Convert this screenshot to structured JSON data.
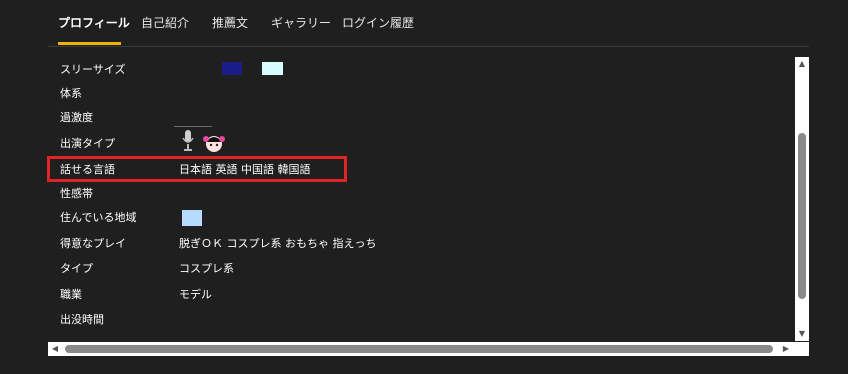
{
  "tabs": [
    {
      "label": "プロフィール",
      "active": true
    },
    {
      "label": "自己紹介",
      "active": false
    },
    {
      "label": "推薦文",
      "active": false
    },
    {
      "label": "ギャラリー",
      "active": false
    },
    {
      "label": "ログイン履歴",
      "active": false
    }
  ],
  "profile": {
    "rows": [
      {
        "label": "スリーサイズ",
        "value": ""
      },
      {
        "label": "体系",
        "value": ""
      },
      {
        "label": "過激度",
        "value": ""
      },
      {
        "label": "出演タイプ",
        "value": ""
      },
      {
        "label": "話せる言語",
        "value": "日本語 英語 中国語 韓国語"
      },
      {
        "label": "性感帯",
        "value": ""
      },
      {
        "label": "住んでいる地域",
        "value": ""
      },
      {
        "label": "得意なプレイ",
        "value": "脱ぎＯＫ コスプレ系 おもちゃ 指えっち"
      },
      {
        "label": "タイプ",
        "value": "コスプレ系"
      },
      {
        "label": "職業",
        "value": "モデル"
      },
      {
        "label": "出没時間",
        "value": ""
      }
    ]
  },
  "colors": {
    "accent": "#f0b400",
    "highlight_border": "#e02424",
    "swatch_navy": "#1b1b8a",
    "swatch_light_cyan": "#d8fbfb",
    "swatch_light_blue": "#b5dcff"
  }
}
